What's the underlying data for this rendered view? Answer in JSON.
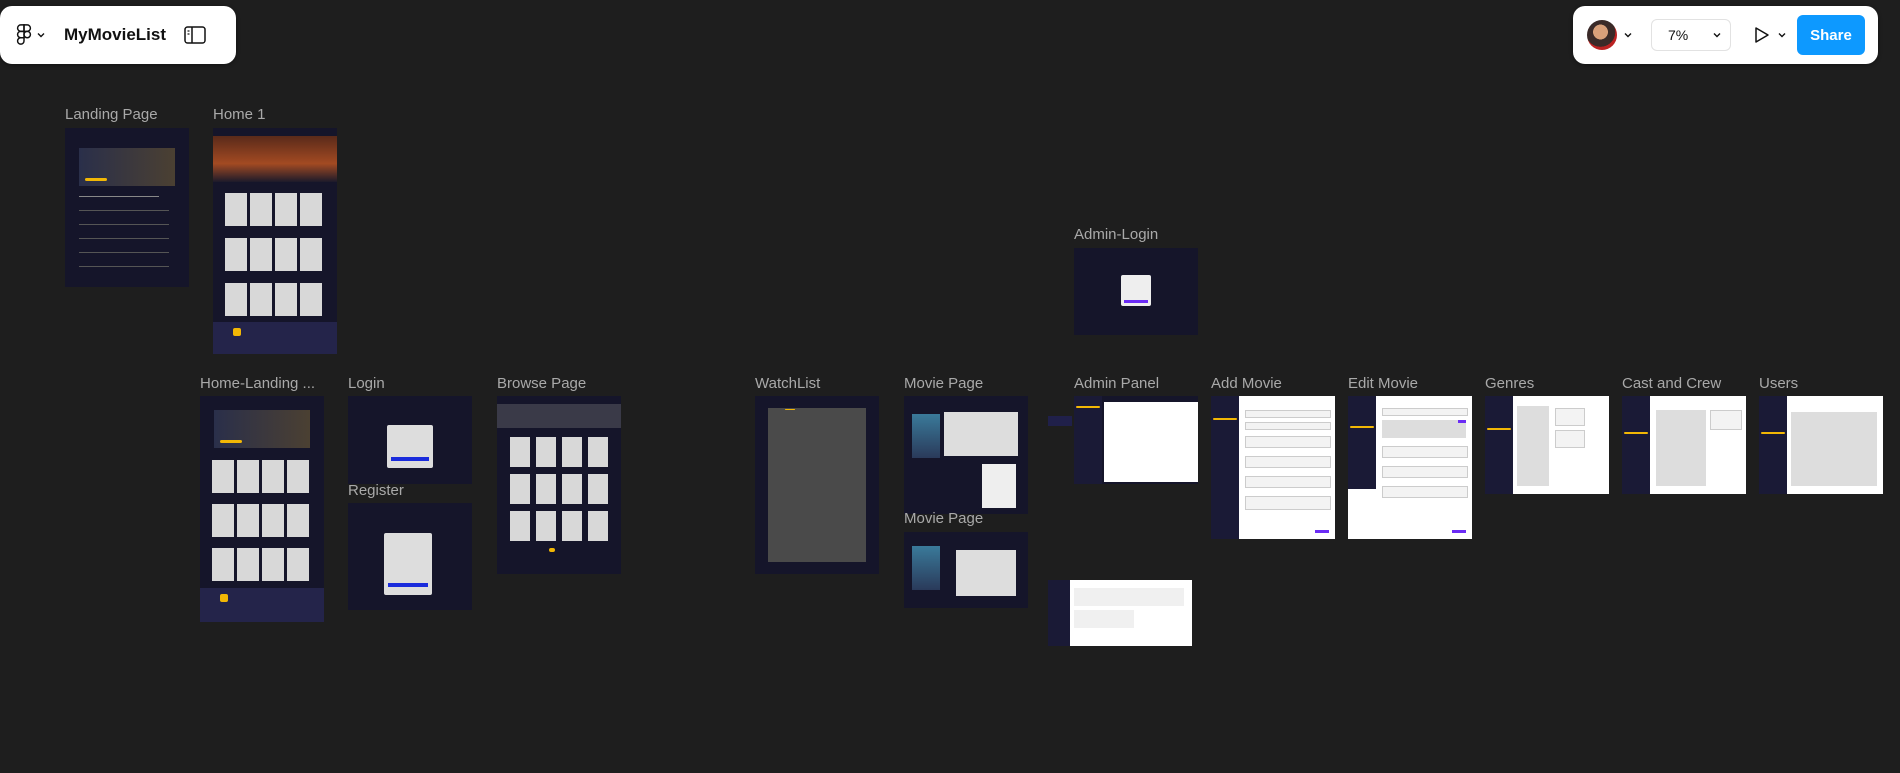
{
  "toolbar": {
    "project_title": "MyMovieList",
    "zoom": "7%",
    "share_label": "Share"
  },
  "icons": {
    "figma": "figma-logo-icon",
    "sidebar": "sidebar-toggle-icon",
    "play": "play-icon",
    "chevron": "chevron-down-icon"
  },
  "colors": {
    "canvas": "#1e1e1e",
    "share": "#0d99ff",
    "frame_dark": "#15152a",
    "accent_yellow": "#f2b705",
    "accent_purple": "#6b2cf5"
  },
  "frames": {
    "landing_page": "Landing Page",
    "home_1": "Home 1",
    "admin_login": "Admin-Login",
    "home_landing": "Home-Landing ...",
    "login": "Login",
    "register": "Register",
    "browse_page": "Browse Page",
    "watchlist": "WatchList",
    "movie_page_1": "Movie Page",
    "movie_page_2": "Movie Page",
    "admin_panel": "Admin Panel",
    "add_movie": "Add Movie",
    "edit_movie": "Edit Movie",
    "genres": "Genres",
    "cast_and_crew": "Cast and Crew",
    "users": "Users"
  }
}
